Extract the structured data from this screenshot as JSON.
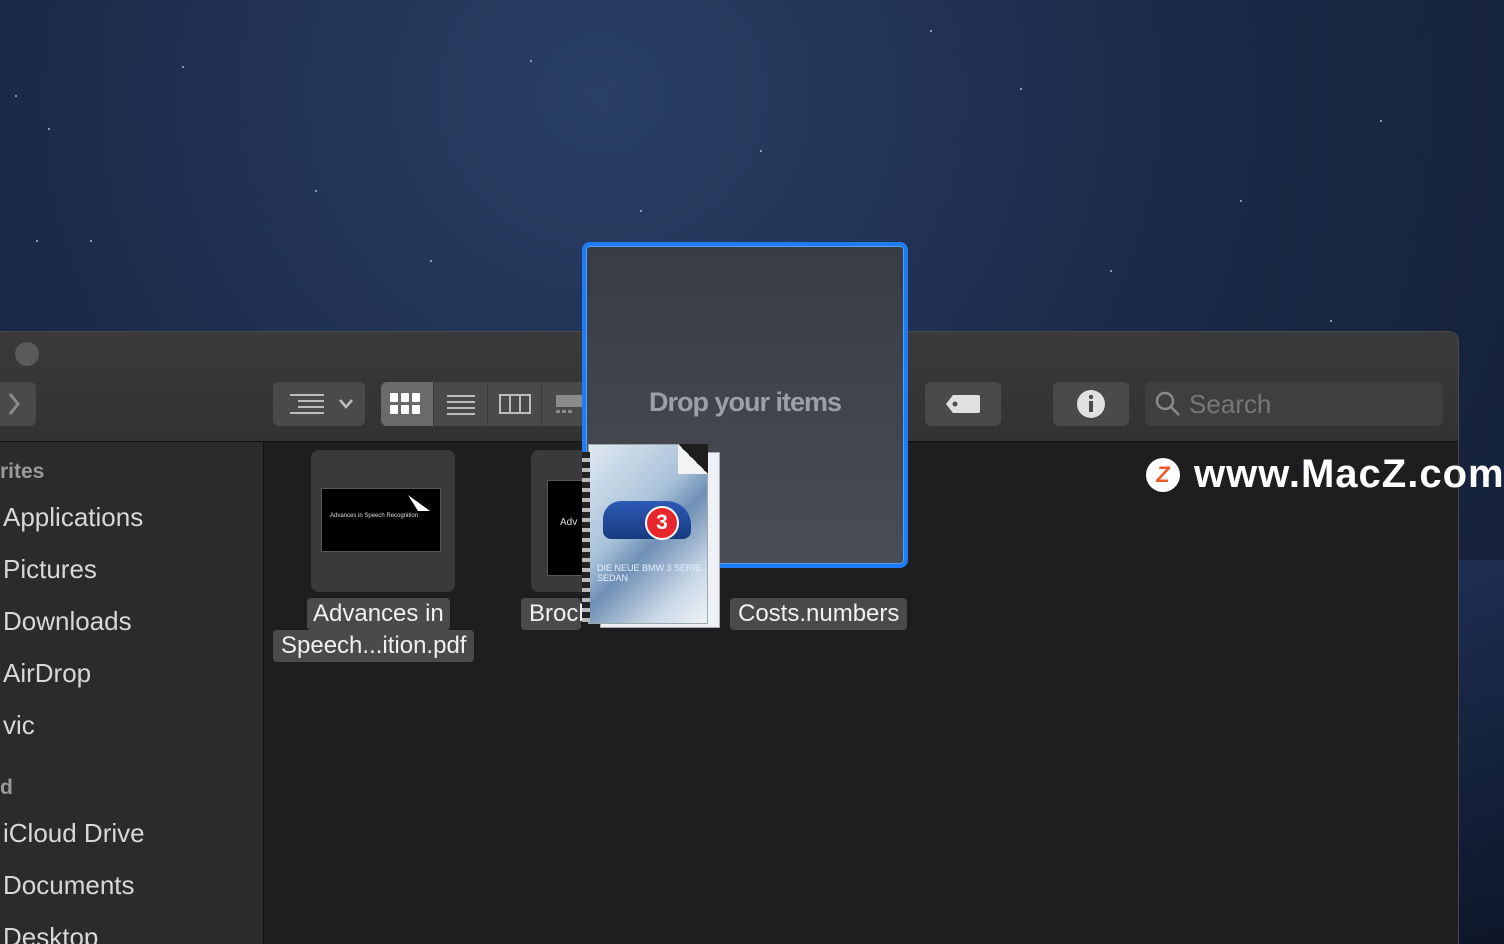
{
  "window": {
    "search_placeholder": "Search"
  },
  "sidebar": {
    "section_favorites": "rites",
    "section_icloud": "d",
    "items": [
      {
        "label": "Applications"
      },
      {
        "label": "Pictures"
      },
      {
        "label": "Downloads"
      },
      {
        "label": "AirDrop"
      },
      {
        "label": "vic"
      },
      {
        "label": "iCloud Drive"
      },
      {
        "label": "Documents"
      },
      {
        "label": "Desktop"
      }
    ]
  },
  "files": [
    {
      "label_line1": "Advances in",
      "label_line2": "Speech...ition.pdf",
      "preview_text": "Advances in Speech Recognition"
    },
    {
      "label": "Broch",
      "preview_text": "Adv"
    },
    {
      "label": "Costs.numbers"
    }
  ],
  "drag": {
    "drop_text": "Drop your items",
    "count": "3",
    "caption": "DIE NEUE BMW 3 SERIE SEDAN"
  },
  "watermark": {
    "logo": "Z",
    "text": "www.MacZ.com"
  },
  "colors": {
    "accent": "#1e7cf5",
    "badge": "#e8272d"
  }
}
